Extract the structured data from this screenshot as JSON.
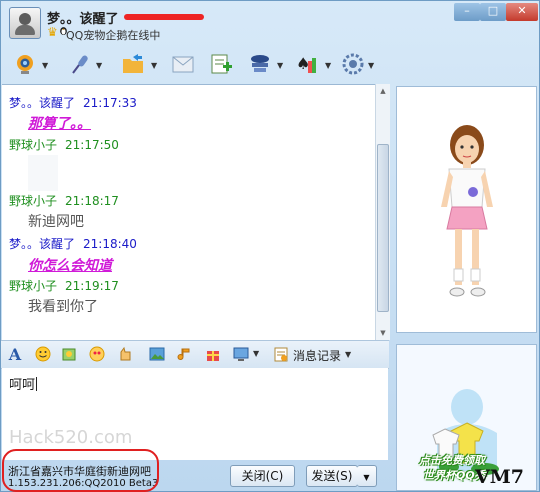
{
  "window": {
    "contact_name": "梦。。该醒了",
    "status": "QQ宠物企鹅在线中",
    "controls": {
      "minimize": "–",
      "maximize": "□",
      "close": "✕"
    }
  },
  "toolbar": {
    "icons": [
      "webcam-icon",
      "microphone-icon",
      "folder-transfer-icon",
      "message-mail-icon",
      "app-add-icon",
      "remote-assist-icon",
      "games-icon",
      "settings-icon"
    ]
  },
  "messages": [
    {
      "sender": "梦。。该醒了",
      "time": "21:17:33",
      "text": "那算了。。",
      "style": "pink"
    },
    {
      "sender": "野球小子",
      "time": "21:17:50",
      "text": "",
      "style": "grey"
    },
    {
      "sender": "野球小子",
      "time": "21:18:17",
      "text": "新迪网吧",
      "style": "grey"
    },
    {
      "sender": "梦。。该醒了",
      "time": "21:18:40",
      "text": "你怎么会知道",
      "style": "pink"
    },
    {
      "sender": "野球小子",
      "time": "21:19:17",
      "text": "我看到你了",
      "style": "grey"
    }
  ],
  "colors": {
    "remote_name": "#1a1ac8",
    "local_name": "#1f8f1f",
    "pink_text": "#d01ad8",
    "grey_text": "#555555"
  },
  "format_bar": {
    "history_label": "消息记录"
  },
  "input": {
    "value": "呵呵"
  },
  "watermark": "Hack520.com",
  "status_lines": [
    "浙江省嘉兴市华庭街新迪网吧",
    "1.153.231.206:QQ2010 Beta3"
  ],
  "buttons": {
    "close_label": "关闭(C)",
    "send_label": "发送(S)"
  },
  "promo": {
    "line1": "点击免费领取",
    "line2": "世界杯QQ秀"
  },
  "corner_label": "VM7"
}
